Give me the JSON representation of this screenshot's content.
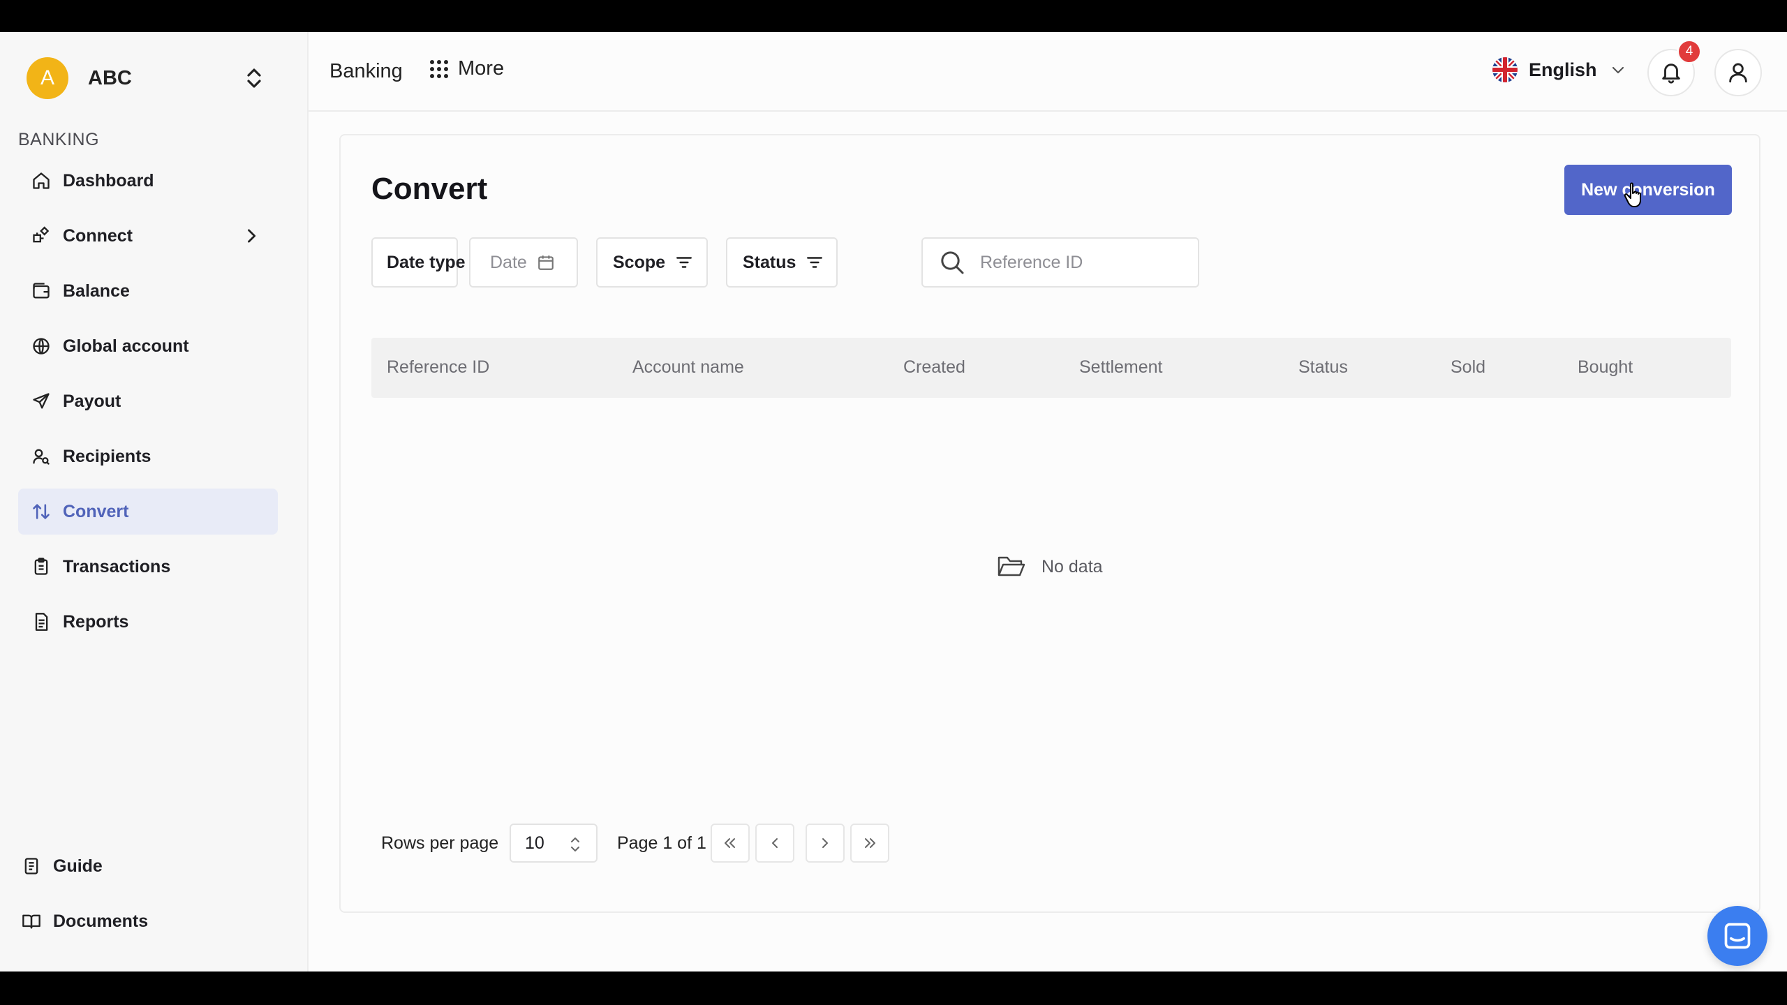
{
  "sidebar": {
    "org": {
      "initial": "A",
      "name": "ABC"
    },
    "section_label": "BANKING",
    "items": [
      {
        "label": "Dashboard",
        "icon": "home-icon"
      },
      {
        "label": "Connect",
        "icon": "connect-icon"
      },
      {
        "label": "Balance",
        "icon": "wallet-icon"
      },
      {
        "label": "Global account",
        "icon": "globe-icon"
      },
      {
        "label": "Payout",
        "icon": "send-icon"
      },
      {
        "label": "Recipients",
        "icon": "user-search-icon"
      },
      {
        "label": "Convert",
        "icon": "arrows-up-down-icon",
        "active": true
      },
      {
        "label": "Transactions",
        "icon": "clipboard-icon"
      },
      {
        "label": "Reports",
        "icon": "document-icon"
      }
    ],
    "bottom_items": [
      {
        "label": "Guide",
        "icon": "guide-icon"
      },
      {
        "label": "Documents",
        "icon": "book-icon"
      }
    ]
  },
  "topbar": {
    "banking": "Banking",
    "more": "More",
    "language": "English",
    "notification_count": "4"
  },
  "main": {
    "title": "Convert",
    "new_button": "New conversion",
    "filters": {
      "date_type": "Date type",
      "date": "Date",
      "scope": "Scope",
      "status": "Status",
      "search_placeholder": "Reference ID"
    },
    "columns": [
      "Reference ID",
      "Account name",
      "Created",
      "Settlement",
      "Status",
      "Sold",
      "Bought"
    ],
    "empty_text": "No data",
    "pagination": {
      "rows_label": "Rows per page",
      "rows_value": "10",
      "page_info": "Page 1 of 1"
    }
  },
  "colors": {
    "accent": "#5266c9",
    "active_bg": "#e8ebf7",
    "avatar": "#f2b417",
    "badge": "#e13b3b",
    "chat": "#3b7ef0"
  }
}
